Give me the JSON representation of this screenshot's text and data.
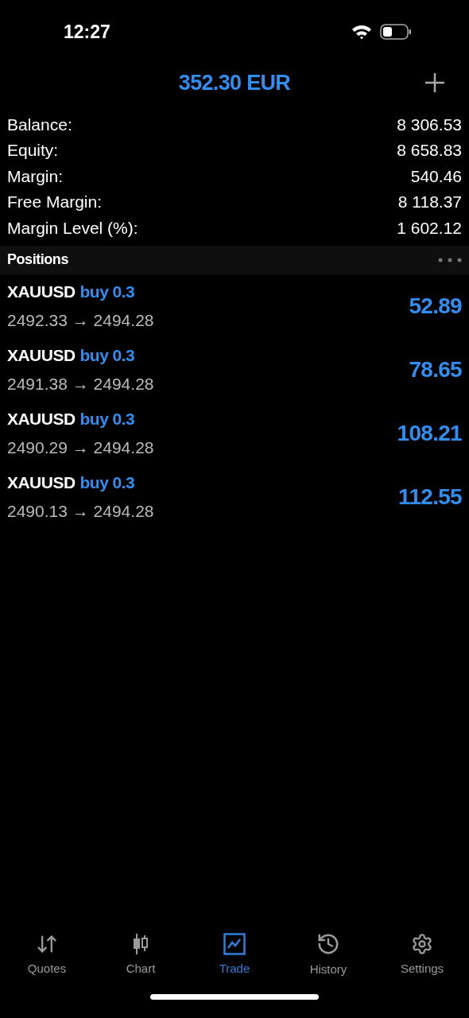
{
  "status_bar": {
    "time": "12:27"
  },
  "header": {
    "title": "352.30 EUR"
  },
  "summary": [
    {
      "label": "Balance:",
      "value": "8 306.53"
    },
    {
      "label": "Equity:",
      "value": "8 658.83"
    },
    {
      "label": "Margin:",
      "value": "540.46"
    },
    {
      "label": "Free Margin:",
      "value": "8 118.37"
    },
    {
      "label": "Margin Level (%):",
      "value": "1 602.12"
    }
  ],
  "positions_header": {
    "title": "Positions"
  },
  "positions": [
    {
      "symbol": "XAUUSD",
      "side": "buy 0.3",
      "prices": "2492.33 → 2494.28",
      "profit": "52.89"
    },
    {
      "symbol": "XAUUSD",
      "side": "buy 0.3",
      "prices": "2491.38 → 2494.28",
      "profit": "78.65"
    },
    {
      "symbol": "XAUUSD",
      "side": "buy 0.3",
      "prices": "2490.29 → 2494.28",
      "profit": "108.21"
    },
    {
      "symbol": "XAUUSD",
      "side": "buy 0.3",
      "prices": "2490.13 → 2494.28",
      "profit": "112.55"
    }
  ],
  "tabs": [
    {
      "label": "Quotes",
      "kind": "quotes",
      "selected": false
    },
    {
      "label": "Chart",
      "kind": "chart",
      "selected": false
    },
    {
      "label": "Trade",
      "kind": "trade",
      "selected": true
    },
    {
      "label": "History",
      "kind": "history",
      "selected": false
    },
    {
      "label": "Settings",
      "kind": "settings",
      "selected": false
    }
  ]
}
